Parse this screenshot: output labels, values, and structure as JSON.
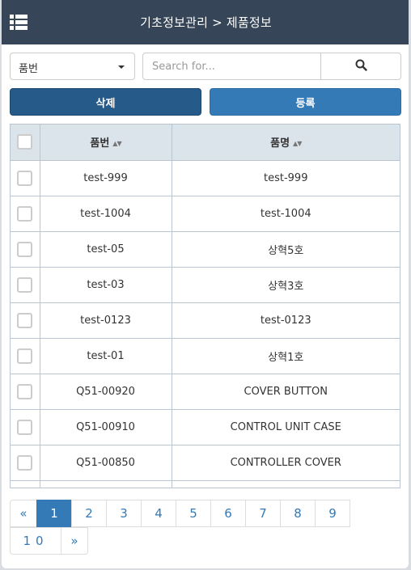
{
  "header": {
    "title": "기초정보관리 > 제품정보",
    "menu_icon": "list-icon"
  },
  "toolbar": {
    "select_value": "품번",
    "search_placeholder": "Search for...",
    "search_value": "",
    "search_icon": "search-icon"
  },
  "actions": {
    "delete_label": "삭제",
    "register_label": "등록"
  },
  "colors": {
    "header_bg": "#364558",
    "delete_btn": "#265a88",
    "register_btn": "#337ab7",
    "table_header_bg": "#dbe3eb",
    "pagination_active": "#337ab7"
  },
  "table": {
    "columns": [
      "품번",
      "품명"
    ],
    "sort_indicator": "▲▼",
    "rows": [
      {
        "code": "test-999",
        "name": "test-999"
      },
      {
        "code": "test-1004",
        "name": "test-1004"
      },
      {
        "code": "test-05",
        "name": "상혁5호"
      },
      {
        "code": "test-03",
        "name": "상혁3호"
      },
      {
        "code": "test-0123",
        "name": "test-0123"
      },
      {
        "code": "test-01",
        "name": "상혁1호"
      },
      {
        "code": "Q51-00920",
        "name": "COVER BUTTON"
      },
      {
        "code": "Q51-00910",
        "name": "CONTROL UNIT CASE"
      },
      {
        "code": "Q51-00850",
        "name": "CONTROLLER COVER"
      },
      {
        "code": "",
        "name": ""
      }
    ]
  },
  "pagination": {
    "prev": "«",
    "next": "»",
    "current_page": "1",
    "pages": [
      "1",
      "2",
      "3",
      "4",
      "5",
      "6",
      "7",
      "8",
      "9",
      "10"
    ]
  }
}
